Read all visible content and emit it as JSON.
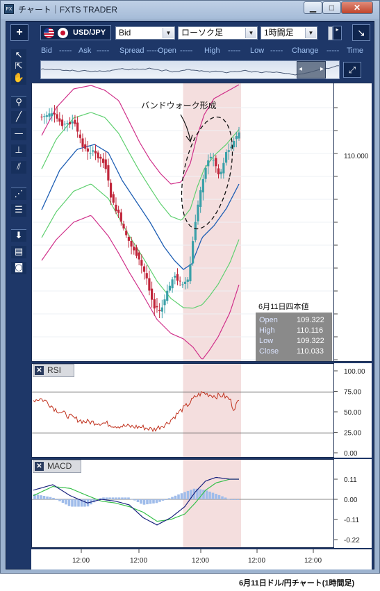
{
  "window": {
    "title": "チャート｜FXTS TRADER",
    "app_icon": "FX",
    "min_glyph": "▁",
    "max_glyph": "□",
    "close_glyph": "✕"
  },
  "toolbar": {
    "add_glyph": "+",
    "pair": "USD/JPY",
    "price_type": "Bid",
    "chart_type": "ローソク足",
    "timeframe": "1時間足",
    "expand_glyph": "↘",
    "dropdown_glyph": "▼",
    "flag_glyph": "▸"
  },
  "quote_strip": [
    {
      "label": "Bid",
      "value": "-----"
    },
    {
      "label": "Ask",
      "value": "-----"
    },
    {
      "label": "Spread",
      "value": "-----"
    },
    {
      "label": "Open",
      "value": "-----"
    },
    {
      "label": "High",
      "value": "-----"
    },
    {
      "label": "Low",
      "value": "-----"
    },
    {
      "label": "Change",
      "value": "-----"
    },
    {
      "label": "Time",
      "value": ""
    }
  ],
  "tools": [
    {
      "name": "pointer-icon",
      "glyph": "↖"
    },
    {
      "name": "crosshair-pointer-icon",
      "glyph": "⇱"
    },
    {
      "name": "hand-pan-icon",
      "glyph": "✋"
    },
    {
      "name": "pin-icon",
      "glyph": "⚲"
    },
    {
      "name": "trend-line-icon",
      "glyph": "╱"
    },
    {
      "name": "horizontal-line-icon",
      "glyph": "—"
    },
    {
      "name": "vertical-line-icon",
      "glyph": "⊥"
    },
    {
      "name": "channel-line-icon",
      "glyph": "⫽"
    },
    {
      "name": "fibonacci-fan-icon",
      "glyph": "⋰"
    },
    {
      "name": "fibonacci-levels-icon",
      "glyph": "☰"
    },
    {
      "name": "download-icon",
      "glyph": "⬇"
    },
    {
      "name": "list-icon",
      "glyph": "▤"
    },
    {
      "name": "camera-icon",
      "glyph": "◙"
    }
  ],
  "nav_glyphs": {
    "left": "◂",
    "right": "▸",
    "zoom": "⤢"
  },
  "annotation": "バンドウォーク形成",
  "ohlc": {
    "title": "6月11日四本値",
    "rows": [
      {
        "k": "Open",
        "v": "109.322"
      },
      {
        "k": "High",
        "v": "110.116"
      },
      {
        "k": "Low",
        "v": "109.322"
      },
      {
        "k": "Close",
        "v": "110.033"
      }
    ]
  },
  "rsi": {
    "label": "RSI",
    "close_glyph": "✕",
    "ticks": [
      "100.00",
      "75.00",
      "50.00",
      "25.00",
      "0.00"
    ]
  },
  "macd": {
    "label": "MACD",
    "close_glyph": "✕",
    "ticks": [
      "0.11",
      "0.00",
      "-0.11",
      "-0.22"
    ]
  },
  "price_axis": {
    "label": "110.000"
  },
  "time_axis": [
    "12:00",
    "12:00",
    "12:00",
    "12:00",
    "12:00"
  ],
  "caption": "6月11日ドル/円チャート(1時間足)",
  "colors": {
    "frame": "#1e3768",
    "bull": "#3aa0a8",
    "bear": "#c0253a",
    "sma": "#1f5fb4",
    "band1": "#5fd070",
    "band2": "#d0308a",
    "highlight": "#f4dede",
    "rsi": "#c0301c",
    "macd": "#1a237e",
    "signal": "#36c04a",
    "hist": "#9fbcea"
  },
  "chart_data": {
    "type": "candlestick",
    "pair": "USD/JPY",
    "timeframe": "1時間足",
    "y_label": "110.000",
    "candle_count": 78,
    "highlight_range_candles": [
      57,
      78
    ],
    "indicators": [
      "Bollinger Bands (±1σ, ±2σ)",
      "RSI",
      "MACD"
    ],
    "rsi_ticks": [
      100,
      75,
      50,
      25,
      0
    ],
    "macd_ticks": [
      0.11,
      0,
      -0.11,
      -0.22
    ],
    "ohlc_june11": {
      "open": 109.322,
      "high": 110.116,
      "low": 109.322,
      "close": 110.033
    }
  }
}
